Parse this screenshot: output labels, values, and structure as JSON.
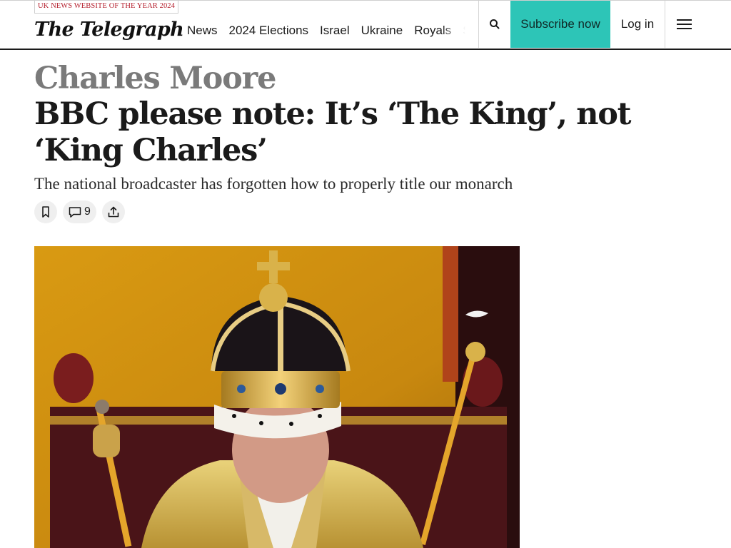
{
  "header": {
    "award_badge": "UK NEWS WEBSITE OF THE YEAR 2024",
    "logo_text": "The Telegraph",
    "nav_items": [
      "News",
      "2024 Elections",
      "Israel",
      "Ukraine",
      "Royals",
      "Sport"
    ],
    "search_icon": "search-icon",
    "subscribe_label": "Subscribe now",
    "login_label": "Log in",
    "menu_icon": "hamburger-menu-icon"
  },
  "article": {
    "author": "Charles Moore",
    "headline": "BBC please note: It’s ‘The King’, not ‘King Charles’",
    "standfirst": "The national broadcaster has forgotten how to properly title our monarch",
    "actions": {
      "bookmark_icon": "bookmark-icon",
      "comment_icon": "comment-icon",
      "comment_count": "9",
      "share_icon": "share-icon"
    },
    "lead_image_subject": "king-crowned-photo"
  },
  "colors": {
    "subscribe_bg": "#2dc5b7",
    "award_red": "#b5202e",
    "author_grey": "#7a7a7a",
    "headline": "#1a1a1a",
    "pill_bg": "#efefef"
  }
}
